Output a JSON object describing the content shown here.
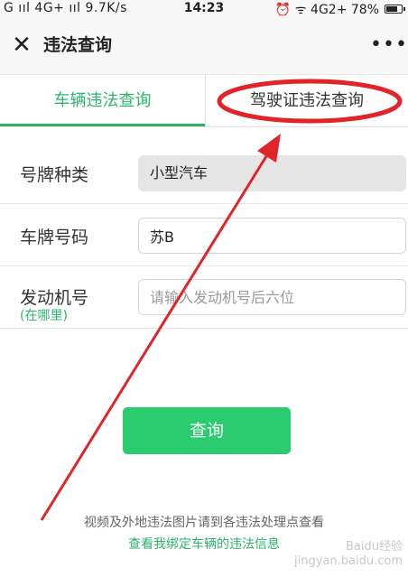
{
  "status_bar": {
    "left": "G ııl 4G+ ııl 9.7K/s",
    "time": "14:23",
    "right": "⏰ ᯤ 4G2+ 78%",
    "battery_level": 0.78
  },
  "titlebar": {
    "close_icon": "close-icon",
    "title": "违法查询",
    "more_icon": "more-icon",
    "more_glyph": "•••"
  },
  "tabs": [
    {
      "label": "车辆违法查询",
      "active": true
    },
    {
      "label": "驾驶证违法查询",
      "active": false
    }
  ],
  "form": {
    "plate_type": {
      "label": "号牌种类",
      "value": "小型汽车"
    },
    "plate_number": {
      "label": "车牌号码",
      "value": "苏B"
    },
    "engine_number": {
      "label": "发动机号",
      "sublabel": "(在哪里)",
      "placeholder": "请输入发动机号后六位"
    }
  },
  "query_button": "查询",
  "footer": {
    "note": "视频及外地违法图片请到各违法处理点查看",
    "link": "查看我绑定车辆的违法信息"
  },
  "watermark": "Baidu经验\njingyan.baidu.com",
  "colors": {
    "accent": "#2bb56c",
    "button": "#2bcc6f",
    "annotation": "#e0242a"
  }
}
